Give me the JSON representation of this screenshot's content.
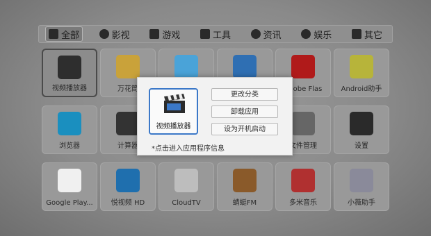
{
  "categories": [
    {
      "label": "全部",
      "icon": "grid-icon",
      "active": true
    },
    {
      "label": "影视",
      "icon": "film-icon",
      "active": false
    },
    {
      "label": "游戏",
      "icon": "gamepad-icon",
      "active": false
    },
    {
      "label": "工具",
      "icon": "tools-icon",
      "active": false
    },
    {
      "label": "资讯",
      "icon": "globe-icon",
      "active": false
    },
    {
      "label": "娱乐",
      "icon": "plus-circle-icon",
      "active": false
    },
    {
      "label": "其它",
      "icon": "apps-icon",
      "active": false
    }
  ],
  "apps": [
    {
      "label": "视频播放器",
      "icon": "clapperboard-icon",
      "color": "#2e2e2e"
    },
    {
      "label": "万花筒",
      "icon": "kaleidoscope-icon",
      "color": "#c9a23a"
    },
    {
      "label": "",
      "icon": "ai-assistant-icon",
      "color": "#4aa3d8"
    },
    {
      "label": "",
      "icon": "tv-icon",
      "color": "#2f6fb3"
    },
    {
      "label": "Adobe Flas",
      "icon": "flash-icon",
      "color": "#b01a1a"
    },
    {
      "label": "Android助手",
      "icon": "android-icon",
      "color": "#b7b43a"
    },
    {
      "label": "浏览器",
      "icon": "browser-globe-icon",
      "color": "#1a8fbf"
    },
    {
      "label": "计算器",
      "icon": "calculator-icon",
      "color": "#333333"
    },
    {
      "label": "",
      "icon": "blank-icon",
      "color": "#999999"
    },
    {
      "label": "",
      "icon": "blank-icon",
      "color": "#999999"
    },
    {
      "label": "文件管理",
      "icon": "folder-icon",
      "color": "#666666"
    },
    {
      "label": "设置",
      "icon": "settings-monitor-icon",
      "color": "#2a2a2a"
    },
    {
      "label": "Google Play...",
      "icon": "play-store-icon",
      "color": "#f0f0f0"
    },
    {
      "label": "悦视频 HD",
      "icon": "video-hd-icon",
      "color": "#1f6fae"
    },
    {
      "label": "CloudTV",
      "icon": "cloudtv-icon",
      "color": "#bdbdbd"
    },
    {
      "label": "蜻蜓FM",
      "icon": "radio-icon",
      "color": "#8a5a2a"
    },
    {
      "label": "多米音乐",
      "icon": "music-icon",
      "color": "#b03030"
    },
    {
      "label": "小薇助手",
      "icon": "voice-assistant-icon",
      "color": "#8a8a9a"
    }
  ],
  "dialog": {
    "app_label": "视频播放器",
    "btn_category": "更改分类",
    "btn_uninstall": "卸载应用",
    "btn_autostart": "设为开机启动",
    "hint": "*点击进入应用程序信息"
  }
}
